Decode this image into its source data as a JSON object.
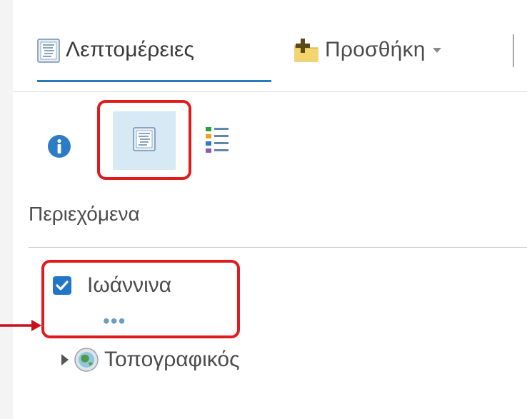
{
  "toolbar": {
    "details_tab_label": "Λεπτομέρειες",
    "add_tab_label": "Προσθήκη",
    "details_tab_icon": "details-document-icon",
    "add_tab_icon": "add-folder-plus-icon",
    "dropdown_icon": "caret-down-icon"
  },
  "panel_buttons": [
    {
      "icon": "info-icon",
      "active": false
    },
    {
      "icon": "details-document-icon",
      "active": true
    },
    {
      "icon": "legend-list-icon",
      "active": false
    }
  ],
  "contents": {
    "heading": "Περιεχόμενα",
    "layers": [
      {
        "name": "Ιωάννινα",
        "checked": true,
        "more_label": "•••"
      }
    ],
    "basemap": {
      "name": "Τοπογραφικός",
      "icon": "globe-icon",
      "expanded": false
    }
  },
  "annotations": {
    "highlight_color": "#e01b1b",
    "arrow_color": "#c8101b"
  },
  "colors": {
    "accent": "#2a79b8",
    "active_button_bg": "#d8e9f6",
    "checkbox": "#2276c7",
    "text": "#4c4c4c"
  }
}
